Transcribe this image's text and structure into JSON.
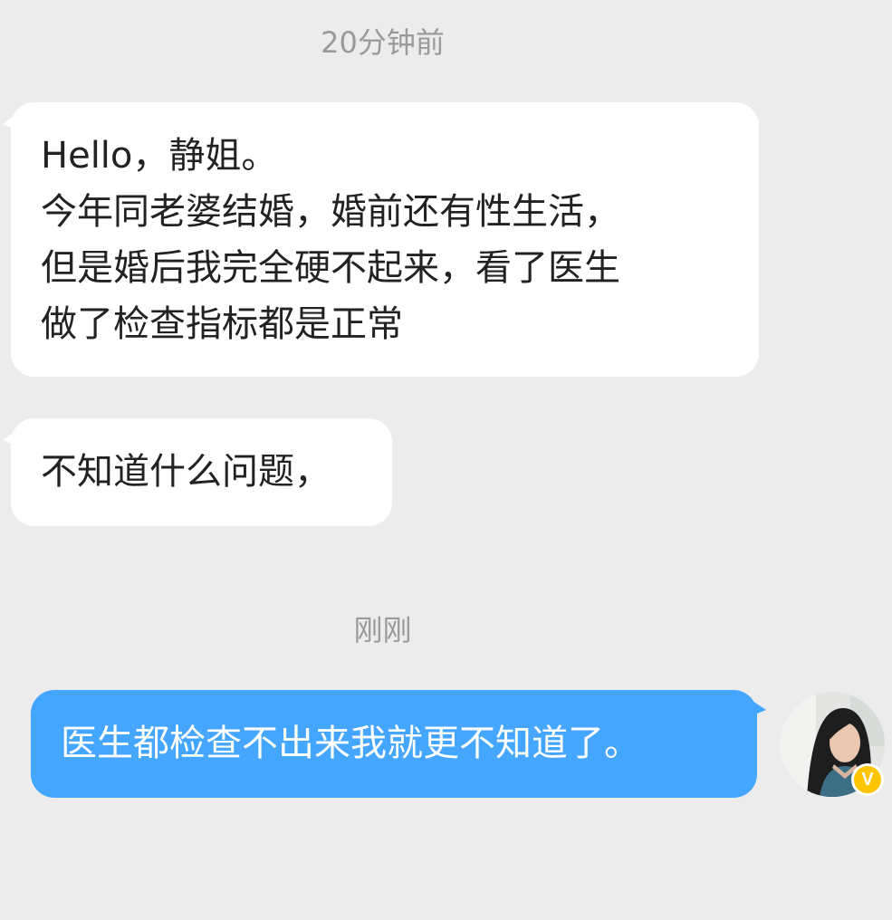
{
  "conversation": {
    "timestamp_1": "20分钟前",
    "timestamp_2": "刚刚",
    "incoming": [
      {
        "lines": [
          "Hello，静姐。",
          "今年同老婆结婚，婚前还有性生活，",
          "但是婚后我完全硬不起来，看了医生",
          "做了检查指标都是正常"
        ]
      },
      {
        "lines": [
          "不知道什么问题，"
        ]
      }
    ],
    "outgoing": [
      {
        "lines": [
          "医生都检查不出来我就更不知道了。"
        ]
      }
    ],
    "avatar": {
      "icon": "user-avatar-photo",
      "badge_label": "V",
      "badge_color": "#ffc400"
    }
  },
  "colors": {
    "background": "#ececec",
    "incoming_bubble": "#ffffff",
    "outgoing_bubble": "#44a6ff",
    "timestamp_text": "#9a9a9a"
  }
}
